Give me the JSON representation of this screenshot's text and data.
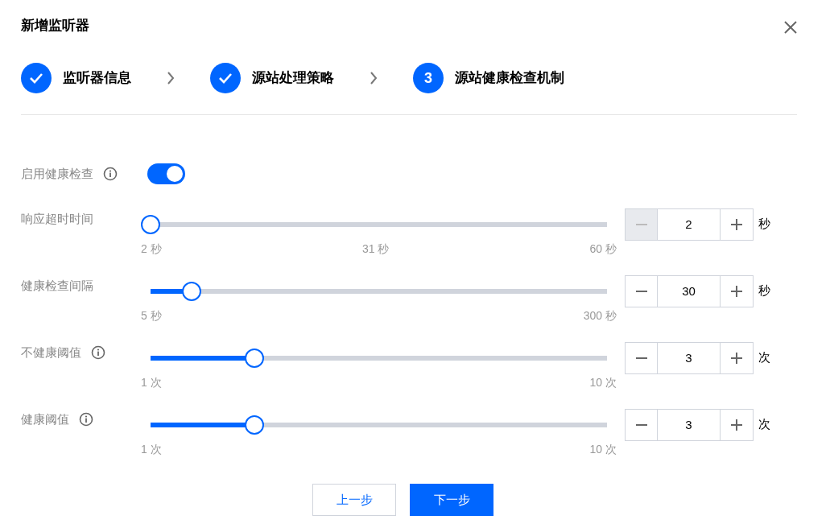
{
  "dialog": {
    "title": "新增监听器"
  },
  "steps": [
    {
      "kind": "done",
      "label": "监听器信息"
    },
    {
      "kind": "done",
      "label": "源站处理策略"
    },
    {
      "kind": "current",
      "number": "3",
      "label": "源站健康检查机制"
    }
  ],
  "toggle": {
    "label": "启用健康检查",
    "on": true
  },
  "sliders": [
    {
      "label": "响应超时时间",
      "info": false,
      "level": 0,
      "marks": [
        "2 秒",
        "31 秒",
        "60 秒"
      ],
      "value": "2",
      "unit": "秒",
      "minus_disabled": true
    },
    {
      "label": "健康检查间隔",
      "info": false,
      "level": 0.09,
      "marks": [
        "5 秒",
        "300 秒"
      ],
      "value": "30",
      "unit": "秒",
      "minus_disabled": false
    },
    {
      "label": "不健康阈值",
      "info": true,
      "level": 0.227,
      "marks": [
        "1 次",
        "10 次"
      ],
      "value": "3",
      "unit": "次",
      "minus_disabled": false
    },
    {
      "label": "健康阈值",
      "info": true,
      "level": 0.227,
      "marks": [
        "1 次",
        "10 次"
      ],
      "value": "3",
      "unit": "次",
      "minus_disabled": false
    }
  ],
  "buttons": [
    {
      "kind": "secondary",
      "label": "上一步"
    },
    {
      "kind": "primary",
      "label": "下一步"
    }
  ]
}
